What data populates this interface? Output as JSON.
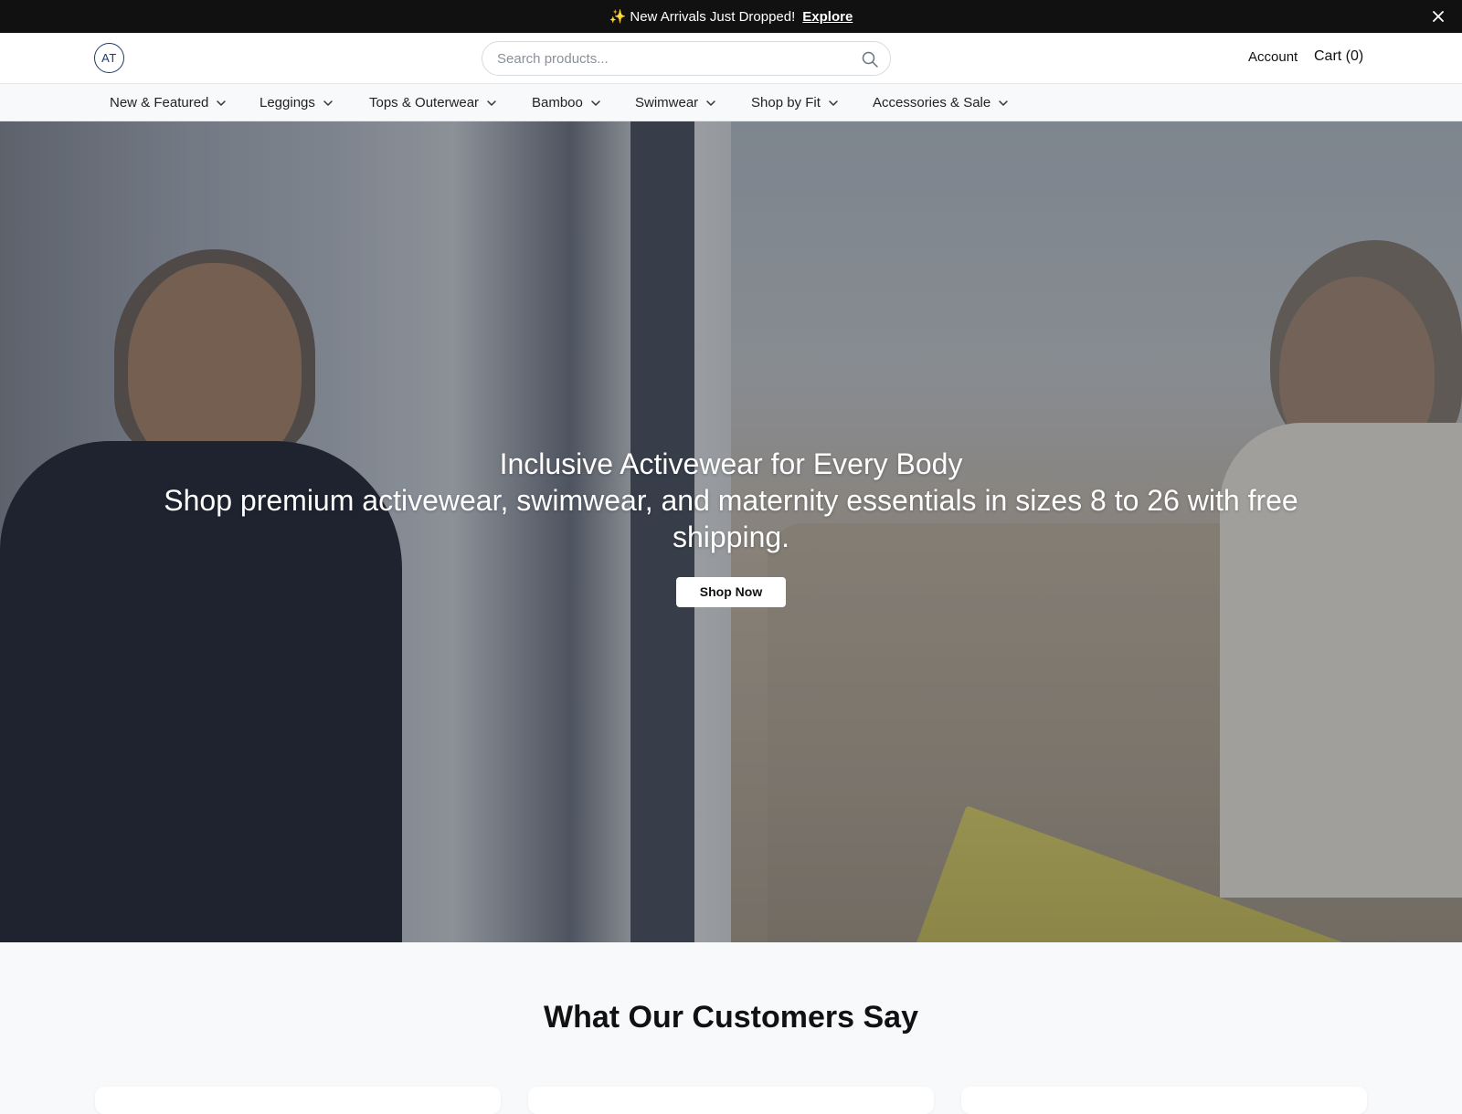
{
  "announcement": {
    "sparkle": "✨",
    "message": "New Arrivals Just Dropped!",
    "link": "Explore",
    "close": "×"
  },
  "header": {
    "logo_text": "AT",
    "search_placeholder": "Search products...",
    "account_label": "Account",
    "cart_label": "Cart (0)"
  },
  "nav": {
    "items": [
      {
        "label": "New & Featured"
      },
      {
        "label": "Leggings"
      },
      {
        "label": "Tops & Outerwear"
      },
      {
        "label": "Bamboo"
      },
      {
        "label": "Swimwear"
      },
      {
        "label": "Shop by Fit"
      },
      {
        "label": "Accessories & Sale"
      }
    ]
  },
  "hero": {
    "title": "Inclusive Activewear for Every Body",
    "subtitle": "Shop premium activewear, swimwear, and maternity essentials in sizes 8 to 26 with free shipping.",
    "cta": "Shop Now"
  },
  "reviews": {
    "title": "What Our Customers Say"
  },
  "colors": {
    "announcement_bg": "#111111",
    "logo": "#1e3a6e",
    "page_bg": "#f8f9fb"
  },
  "icons": {
    "search": "search-icon",
    "chevron": "chevron-down-icon",
    "close": "close-icon"
  }
}
